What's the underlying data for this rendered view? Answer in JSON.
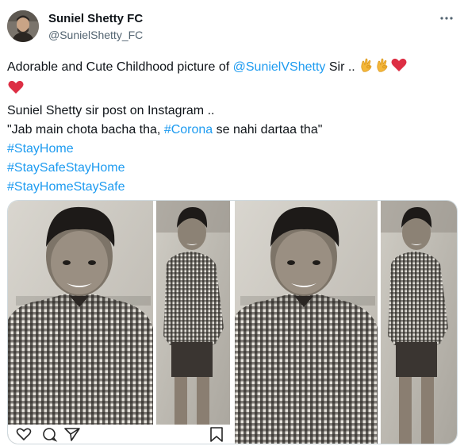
{
  "tweet": {
    "display_name": "Suniel Shetty FC",
    "handle": "@SunielShetty_FC",
    "more_icon": "more-horizontal-icon",
    "body": {
      "line1_text": "Adorable and Cute Childhood picture of ",
      "mention": "@SunielVShetty",
      "line1_after": " Sir .. ",
      "line2": "Suniel Shetty sir post on Instagram ..",
      "line3_before": "\"Jab main chota bacha tha, ",
      "line3_hashtag": "#Corona",
      "line3_after": " se nahi dartaa tha\"",
      "hashtags": [
        "#StayHome",
        "#StaySafeStayHome",
        "#StayHomeStaySafe"
      ],
      "emojis": [
        "ok-hand-emoji",
        "ok-hand-emoji",
        "red-heart-emoji",
        "red-heart-emoji"
      ]
    },
    "media": {
      "images": [
        {
          "name": "instagram-screenshot-photo"
        },
        {
          "name": "childhood-photo"
        }
      ],
      "instagram_icons": [
        "heart-outline-icon",
        "comment-icon",
        "send-icon",
        "bookmark-icon"
      ]
    },
    "colors": {
      "link": "#1d9bf0",
      "text": "#0f1419",
      "secondary": "#536471",
      "border": "#cfd9de"
    }
  }
}
